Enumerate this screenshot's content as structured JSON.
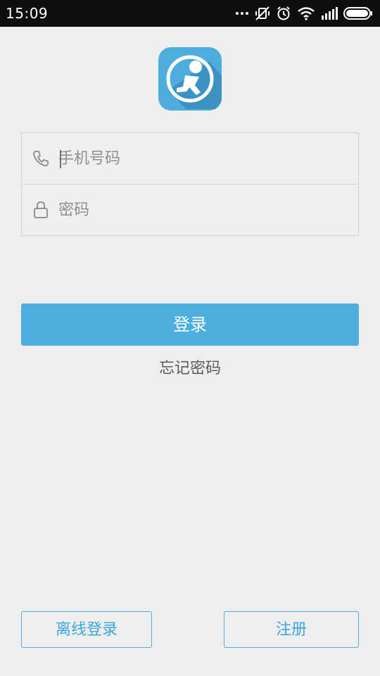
{
  "status_bar": {
    "time": "15:09",
    "icons": [
      "more-dots-icon",
      "vibrate-icon",
      "alarm-icon",
      "wifi-icon",
      "signal-icon",
      "battery-icon"
    ]
  },
  "app": {
    "logo_icon": "runner-logo-icon",
    "brand_color": "#4cafe0"
  },
  "form": {
    "phone_placeholder": "手机号码",
    "password_placeholder": "密码",
    "phone_icon": "phone-icon",
    "password_icon": "lock-icon"
  },
  "actions": {
    "login_label": "登录",
    "forgot_label": "忘记密码",
    "offline_login_label": "离线登录",
    "register_label": "注册"
  }
}
